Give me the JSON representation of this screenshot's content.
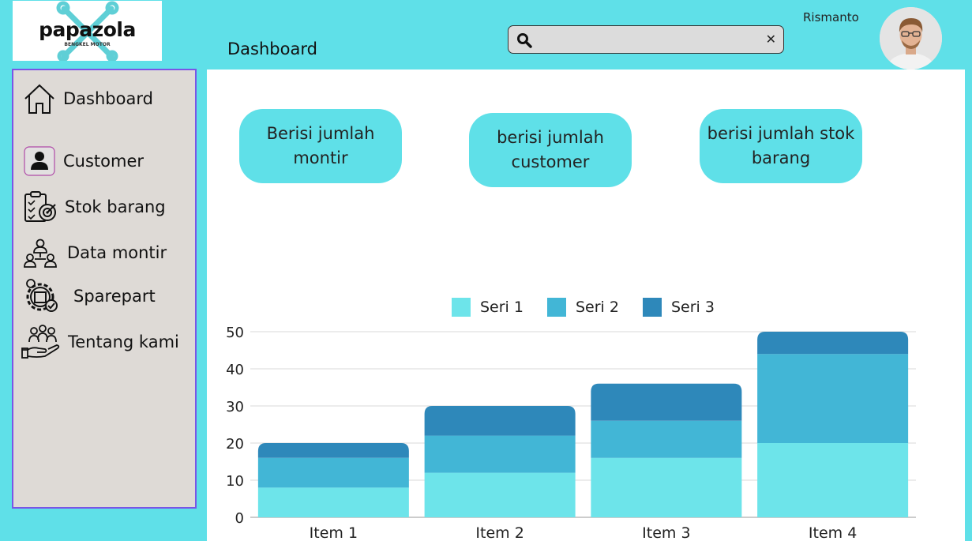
{
  "logo": {
    "name": "papazola",
    "subtitle": "BENGKEL MOTOR"
  },
  "header": {
    "title": "Dashboard",
    "search": {
      "value": "",
      "placeholder": ""
    },
    "user": "Rismanto"
  },
  "sidebar": {
    "items": [
      {
        "label": "Dashboard",
        "icon": "home-icon"
      },
      {
        "label": "Customer",
        "icon": "user-icon"
      },
      {
        "label": "Stok barang",
        "icon": "checklist-target-icon"
      },
      {
        "label": "Data montir",
        "icon": "team-icon"
      },
      {
        "label": "Sparepart",
        "icon": "gear-box-icon"
      },
      {
        "label": "Tentang kami",
        "icon": "hand-people-icon"
      }
    ]
  },
  "cards": [
    {
      "text": "Berisi jumlah montir"
    },
    {
      "text": "berisi jumlah customer"
    },
    {
      "text": "berisi jumlah stok barang"
    }
  ],
  "colors": {
    "accent": "#5fe0e8",
    "sidebar_bg": "#dedad6",
    "sidebar_border": "#7a55e6"
  },
  "chart_data": {
    "type": "bar",
    "stacked": true,
    "categories": [
      "Item 1",
      "Item 2",
      "Item 3",
      "Item 4"
    ],
    "series": [
      {
        "name": "Seri 1",
        "values": [
          8,
          12,
          16,
          20
        ],
        "color": "#6de4ea"
      },
      {
        "name": "Seri 2",
        "values": [
          8,
          10,
          10,
          24
        ],
        "color": "#42b6d6"
      },
      {
        "name": "Seri 3",
        "values": [
          4,
          8,
          10,
          6
        ],
        "color": "#2e88ba"
      }
    ],
    "ylim": [
      0,
      50
    ],
    "yticks": [
      0,
      10,
      20,
      30,
      40,
      50
    ],
    "grid": true,
    "legend": "top"
  }
}
